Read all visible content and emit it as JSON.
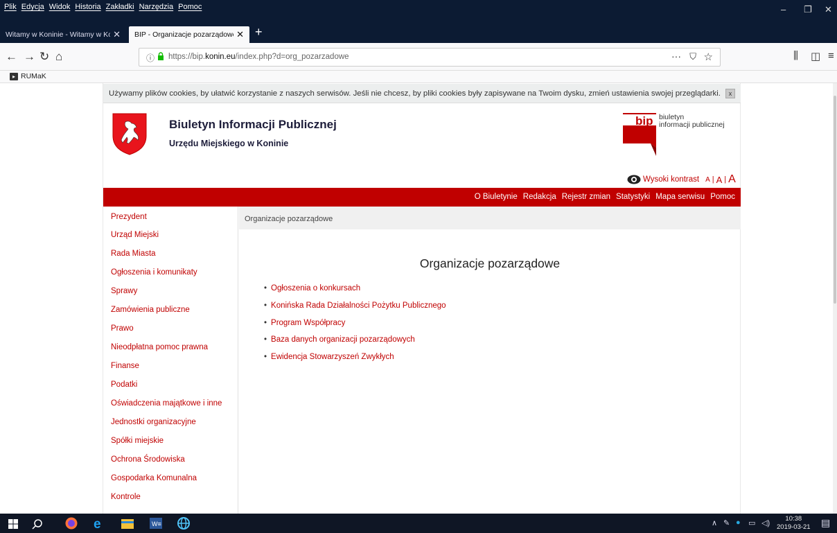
{
  "browser": {
    "menus": [
      "Plik",
      "Edycja",
      "Widok",
      "Historia",
      "Zakładki",
      "Narzędzia",
      "Pomoc"
    ],
    "tabs": [
      {
        "label": "Witamy w Koninie - Witamy w Konin",
        "active": false
      },
      {
        "label": "BIP - Organizacje pozarządowe",
        "active": true
      }
    ],
    "url_prefix": "https://bip.",
    "url_domain": "konin.eu",
    "url_path": "/index.php?d=org_pozarzadowe",
    "bookmark": "RUMaK",
    "urlbar_menu": "···"
  },
  "cookie": {
    "text": "Używamy plików cookies, by ułatwić korzystanie z naszych serwisów. Jeśli nie chcesz, by pliki cookies były zapisywane na Twoim dysku, zmień ustawienia swojej przeglądarki.",
    "close": "x"
  },
  "header": {
    "title": "Biuletyn Informacji Publicznej",
    "subtitle": "Urzędu Miejskiego w Koninie",
    "logo_bip": "bip",
    "logo_text_1": "biuletyn",
    "logo_text_2": "informacji publicznej",
    "contrast": "Wysoki kontrast",
    "font_sizes": [
      "A",
      "A",
      "A"
    ],
    "sep": "|"
  },
  "topnav": [
    "O Biuletynie",
    "Redakcja",
    "Rejestr zmian",
    "Statystyki",
    "Mapa serwisu",
    "Pomoc"
  ],
  "sidebar": [
    "Prezydent",
    "Urząd Miejski",
    "Rada Miasta",
    "Ogłoszenia i komunikaty",
    "Sprawy",
    "Zamówienia publiczne",
    "Prawo",
    "Nieodpłatna pomoc prawna",
    "Finanse",
    "Podatki",
    "Oświadczenia majątkowe i inne",
    "Jednostki organizacyjne",
    "Spółki miejskie",
    "Ochrona Środowiska",
    "Gospodarka Komunalna",
    "Kontrole"
  ],
  "breadcrumb": "Organizacje pozarządowe",
  "main": {
    "title": "Organizacje pozarządowe",
    "items": [
      "Ogłoszenia o konkursach",
      "Konińska Rada Działalności Pożytku Publicznego",
      "Program Współpracy",
      "Baza danych organizacji pozarządowych",
      "Ewidencja Stowarzyszeń Zwykłych"
    ]
  },
  "taskbar": {
    "time": "10:38",
    "date": "2019-03-21"
  },
  "colors": {
    "accent": "#c00000",
    "browser_dark": "#0c1b33"
  }
}
